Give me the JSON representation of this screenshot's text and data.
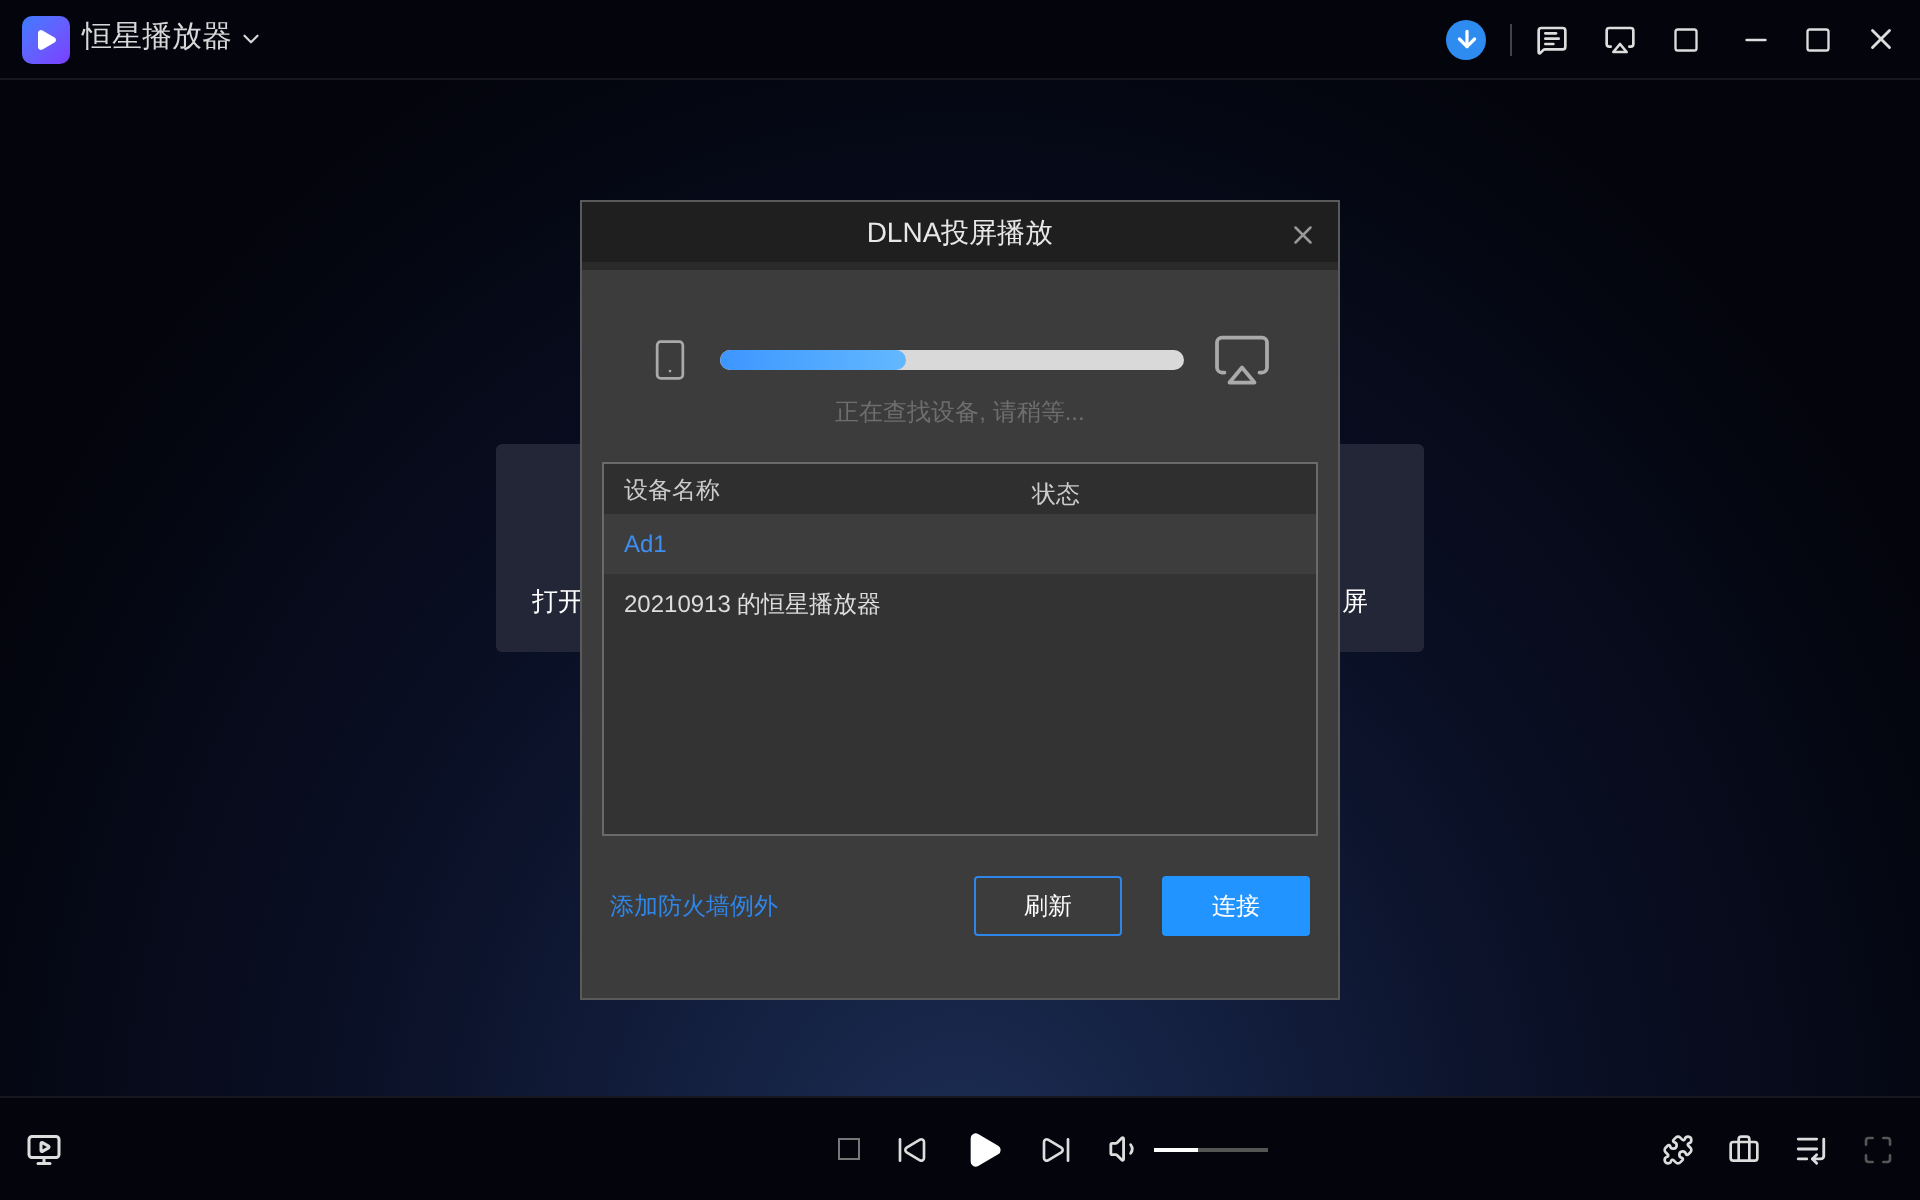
{
  "app": {
    "title": "恒星播放器"
  },
  "background_cards": [
    {
      "label": "打开"
    },
    {
      "label": "屏"
    }
  ],
  "dialog": {
    "title": "DLNA投屏播放",
    "search": {
      "level": 0.4,
      "status": "正在查找设备, 请稍等..."
    },
    "table": {
      "columns": [
        "设备名称",
        "状态"
      ],
      "rows": [
        {
          "name": "Ad1",
          "selected": true
        },
        {
          "name": "20210913 的恒星播放器",
          "selected": false
        }
      ]
    },
    "firewall_link": "添加防火墙例外",
    "buttons": [
      {
        "label": "刷新",
        "kind": "outline"
      },
      {
        "label": "连接",
        "kind": "primary"
      }
    ]
  },
  "player": {
    "volume": {
      "level": 0.4
    },
    "fullscreen_disabled": true
  }
}
